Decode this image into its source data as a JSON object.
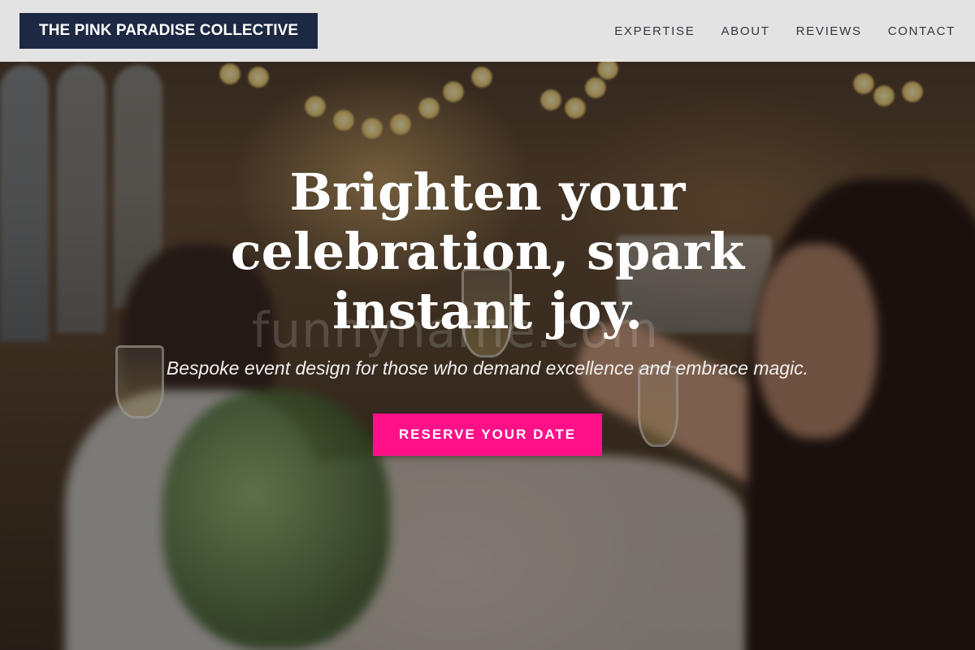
{
  "header": {
    "brand": "THE PINK PARADISE COLLECTIVE",
    "nav": [
      {
        "label": "EXPERTISE"
      },
      {
        "label": "ABOUT"
      },
      {
        "label": "REVIEWS"
      },
      {
        "label": "CONTACT"
      }
    ]
  },
  "hero": {
    "headline": "Brighten your celebration, spark instant joy.",
    "subheadline": "Bespoke event design for those who demand excellence and embrace magic.",
    "cta_label": "RESERVE YOUR DATE",
    "watermark": "funnyname.com",
    "background_image": "celebration-toast-photo"
  },
  "colors": {
    "brand_bg": "#1d2942",
    "cta_bg": "#ff0f88",
    "header_bg": "#f2f2f2"
  }
}
